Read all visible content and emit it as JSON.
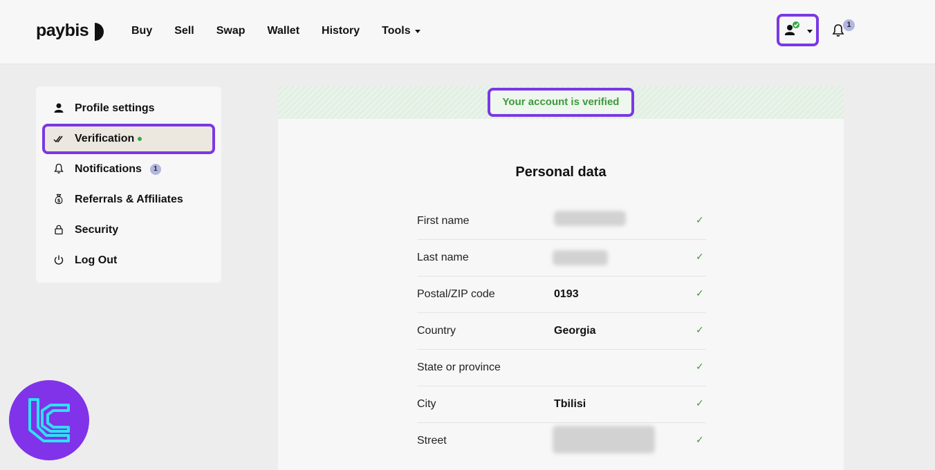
{
  "brand": {
    "name": "paybis"
  },
  "nav": {
    "items": [
      "Buy",
      "Sell",
      "Swap",
      "Wallet",
      "History",
      "Tools"
    ]
  },
  "header": {
    "notifications_count": "1",
    "account_icon": "user-verified-icon"
  },
  "sidebar": {
    "items": [
      {
        "label": "Profile settings",
        "icon": "user-icon"
      },
      {
        "label": "Verification",
        "icon": "double-check-icon"
      },
      {
        "label": "Notifications",
        "icon": "bell-icon",
        "badge": "1"
      },
      {
        "label": "Referrals & Affiliates",
        "icon": "money-bag-icon"
      },
      {
        "label": "Security",
        "icon": "lock-icon"
      },
      {
        "label": "Log Out",
        "icon": "power-icon"
      }
    ],
    "active": "Verification"
  },
  "main": {
    "verified_banner": "Your account is verified",
    "title": "Personal data",
    "rows": [
      {
        "label": "First name",
        "value": ""
      },
      {
        "label": "Last name",
        "value": ""
      },
      {
        "label": "Postal/ZIP code",
        "value": "0193"
      },
      {
        "label": "Country",
        "value": "Georgia"
      },
      {
        "label": "State or province",
        "value": ""
      },
      {
        "label": "City",
        "value": "Tbilisi"
      },
      {
        "label": "Street",
        "value": ""
      }
    ]
  },
  "colors": {
    "accent": "#7a38e6",
    "verified_green": "#3c9a3c",
    "badge": "#b3b6e0"
  }
}
